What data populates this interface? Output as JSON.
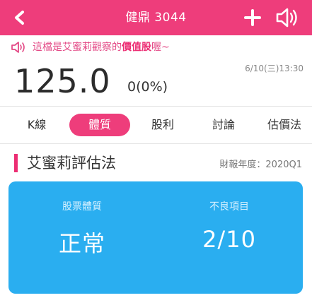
{
  "header": {
    "title": "健鼎 3044"
  },
  "notice": {
    "prefix": "這檔是艾蜜莉觀察的",
    "highlight": "價值股",
    "suffix": "喔~"
  },
  "quote": {
    "price": "125.0",
    "change": "0(0%)",
    "timestamp": "6/10(三)13:30"
  },
  "tabs": [
    {
      "label": "K線",
      "active": false
    },
    {
      "label": "體質",
      "active": true
    },
    {
      "label": "股利",
      "active": false
    },
    {
      "label": "討論",
      "active": false
    },
    {
      "label": "估價法",
      "active": false
    }
  ],
  "section": {
    "title": "艾蜜莉評估法",
    "fiscal_period": "財報年度：2020Q1"
  },
  "card": {
    "metrics": [
      {
        "label": "股票體質",
        "value": "正常"
      },
      {
        "label": "不良項目",
        "value": "2/10"
      }
    ]
  },
  "colors": {
    "brand_pink": "#ee3d7b",
    "card_blue": "#2aaef0"
  },
  "icons": [
    "back-arrow-icon",
    "plus-icon",
    "speaker-icon",
    "notice-speaker-icon"
  ]
}
